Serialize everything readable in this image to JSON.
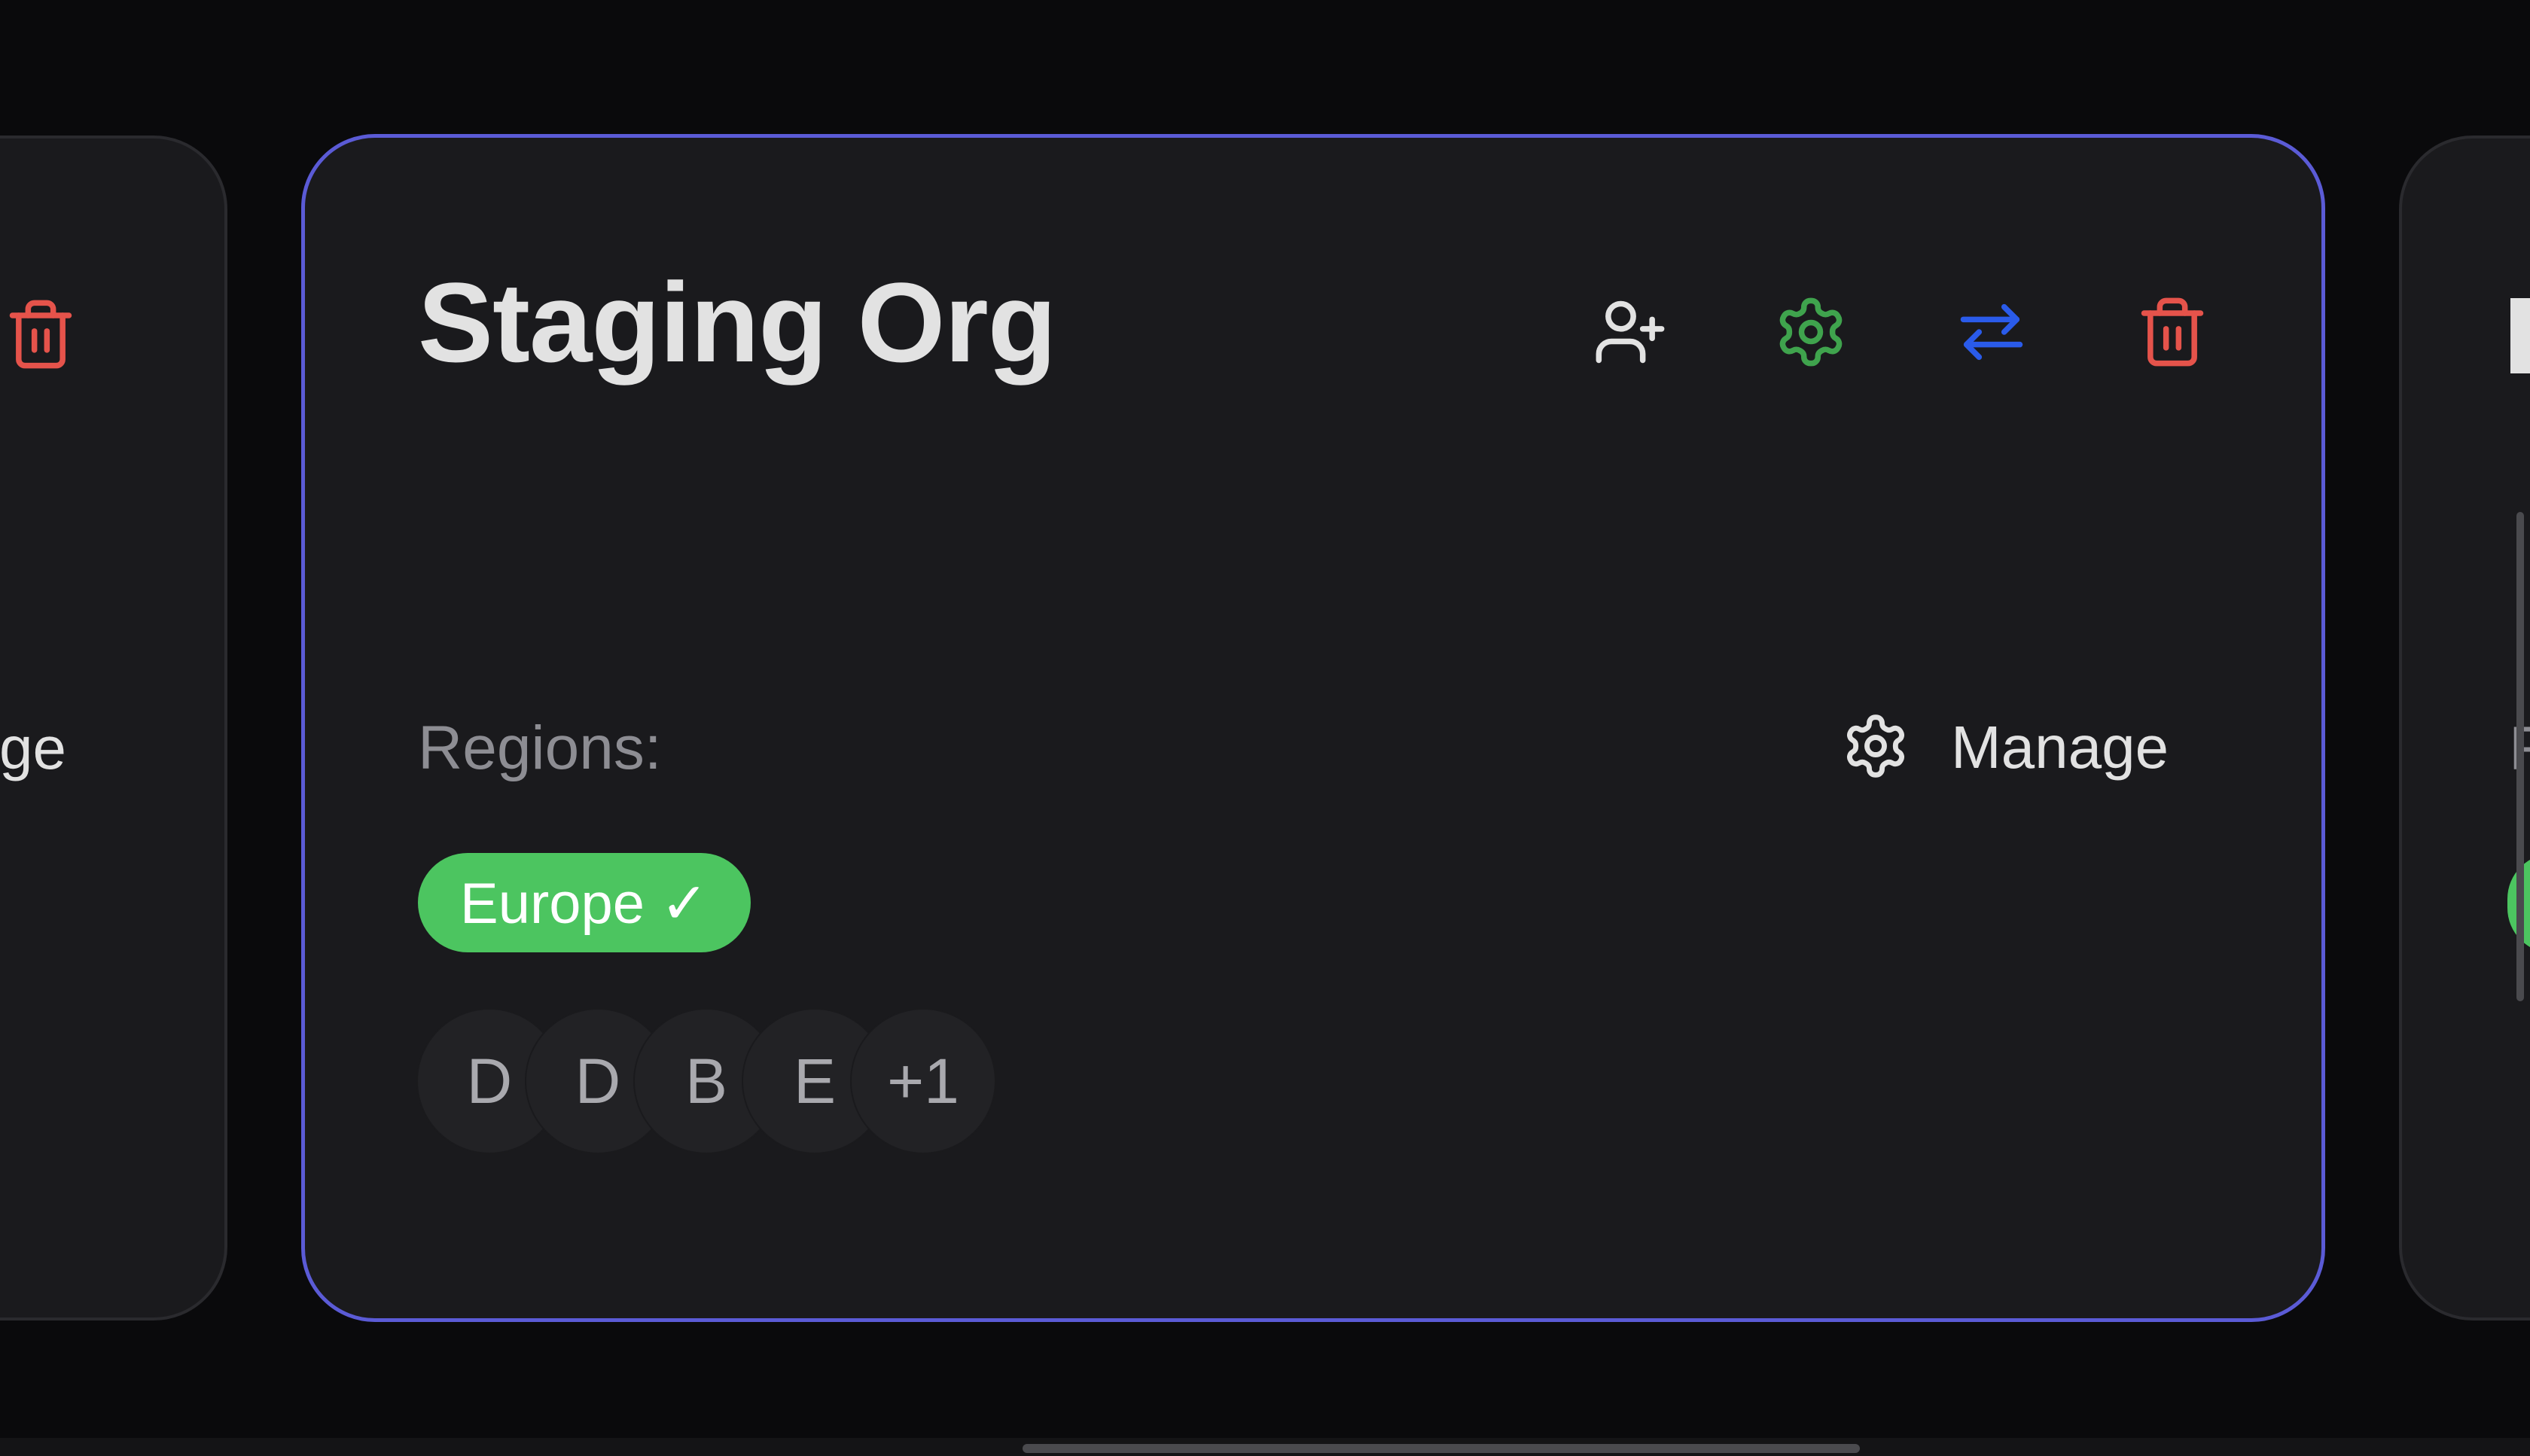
{
  "colors": {
    "background": "#0a0a0c",
    "card": "#1a1a1d",
    "card_border": "#2a2a2e",
    "selected_border": "#5b5bd6",
    "title_text": "#e2e2e2",
    "muted_text": "#8d8d93",
    "success": "#4cc560",
    "settings_green": "#3fa34d",
    "transfer_blue": "#2a5bea",
    "danger_red": "#e5534b"
  },
  "prev_card": {
    "manage_label_fragment": "ge",
    "icons": [
      "trash-icon"
    ]
  },
  "main_card": {
    "title": "Staging Org",
    "actions": [
      {
        "name": "add-member",
        "icon": "user-plus-icon"
      },
      {
        "name": "settings",
        "icon": "gear-icon"
      },
      {
        "name": "transfer",
        "icon": "arrows-swap-icon"
      },
      {
        "name": "delete",
        "icon": "trash-icon"
      }
    ],
    "regions_label": "Regions:",
    "manage_label": "Manage",
    "region_badge": "Europe ✓",
    "members": [
      "D",
      "D",
      "B",
      "E",
      "+1"
    ]
  },
  "next_card": {
    "regions_label_fragment": "R"
  }
}
